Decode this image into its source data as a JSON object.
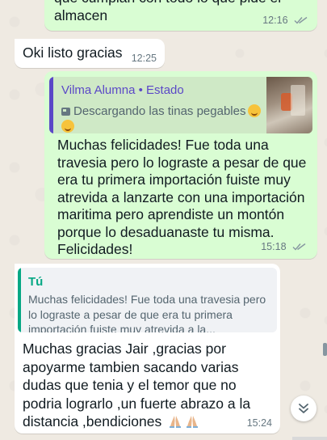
{
  "messages": [
    {
      "direction": "outgoing",
      "text": "que cumplan con todo lo que pide el almacen",
      "time": "12:16",
      "status": "read"
    },
    {
      "direction": "incoming",
      "text": "Oki listo gracias",
      "time": "12:25"
    },
    {
      "direction": "outgoing",
      "quote": {
        "author": "Vilma Alumna • Estado",
        "text": "Descargando las tinas pegables",
        "emoji": "😂"
      },
      "text": "Muchas felicidades! Fue toda una travesia pero lo lograste a pesar de que era tu primera importación fuiste muy atrevida a lanzarte con una importación maritima pero aprendiste un montón porque lo desaduanaste tu misma. Felicidades!",
      "time": "15:18",
      "status": "read"
    },
    {
      "direction": "incoming",
      "quote": {
        "author": "Tú",
        "text": "Muchas felicidades! Fue toda una travesia pero lo lograste a pesar de que era tu primera importación fuiste muy atrevida a la..."
      },
      "text": "Muchas gracias Jair ,gracias por apoyarme tambien sacando varias dudas que tenia y el temor que no podria lograrlo ,un fuerte abrazo a la distancia ,bendiciones",
      "emoji": "🙏🙏",
      "time": "15:24"
    }
  ],
  "colors": {
    "outgoing_bubble": "#d9fdd3",
    "incoming_bubble": "#ffffff",
    "wallpaper": "#efeae2",
    "status_author": "#5b48c7",
    "reply_author": "#06a884",
    "read_ticks": "#8696a0"
  },
  "icons": {
    "scroll_down": "chevron-double-down-icon",
    "read_receipt": "double-check-icon",
    "status_media": "image-icon"
  }
}
